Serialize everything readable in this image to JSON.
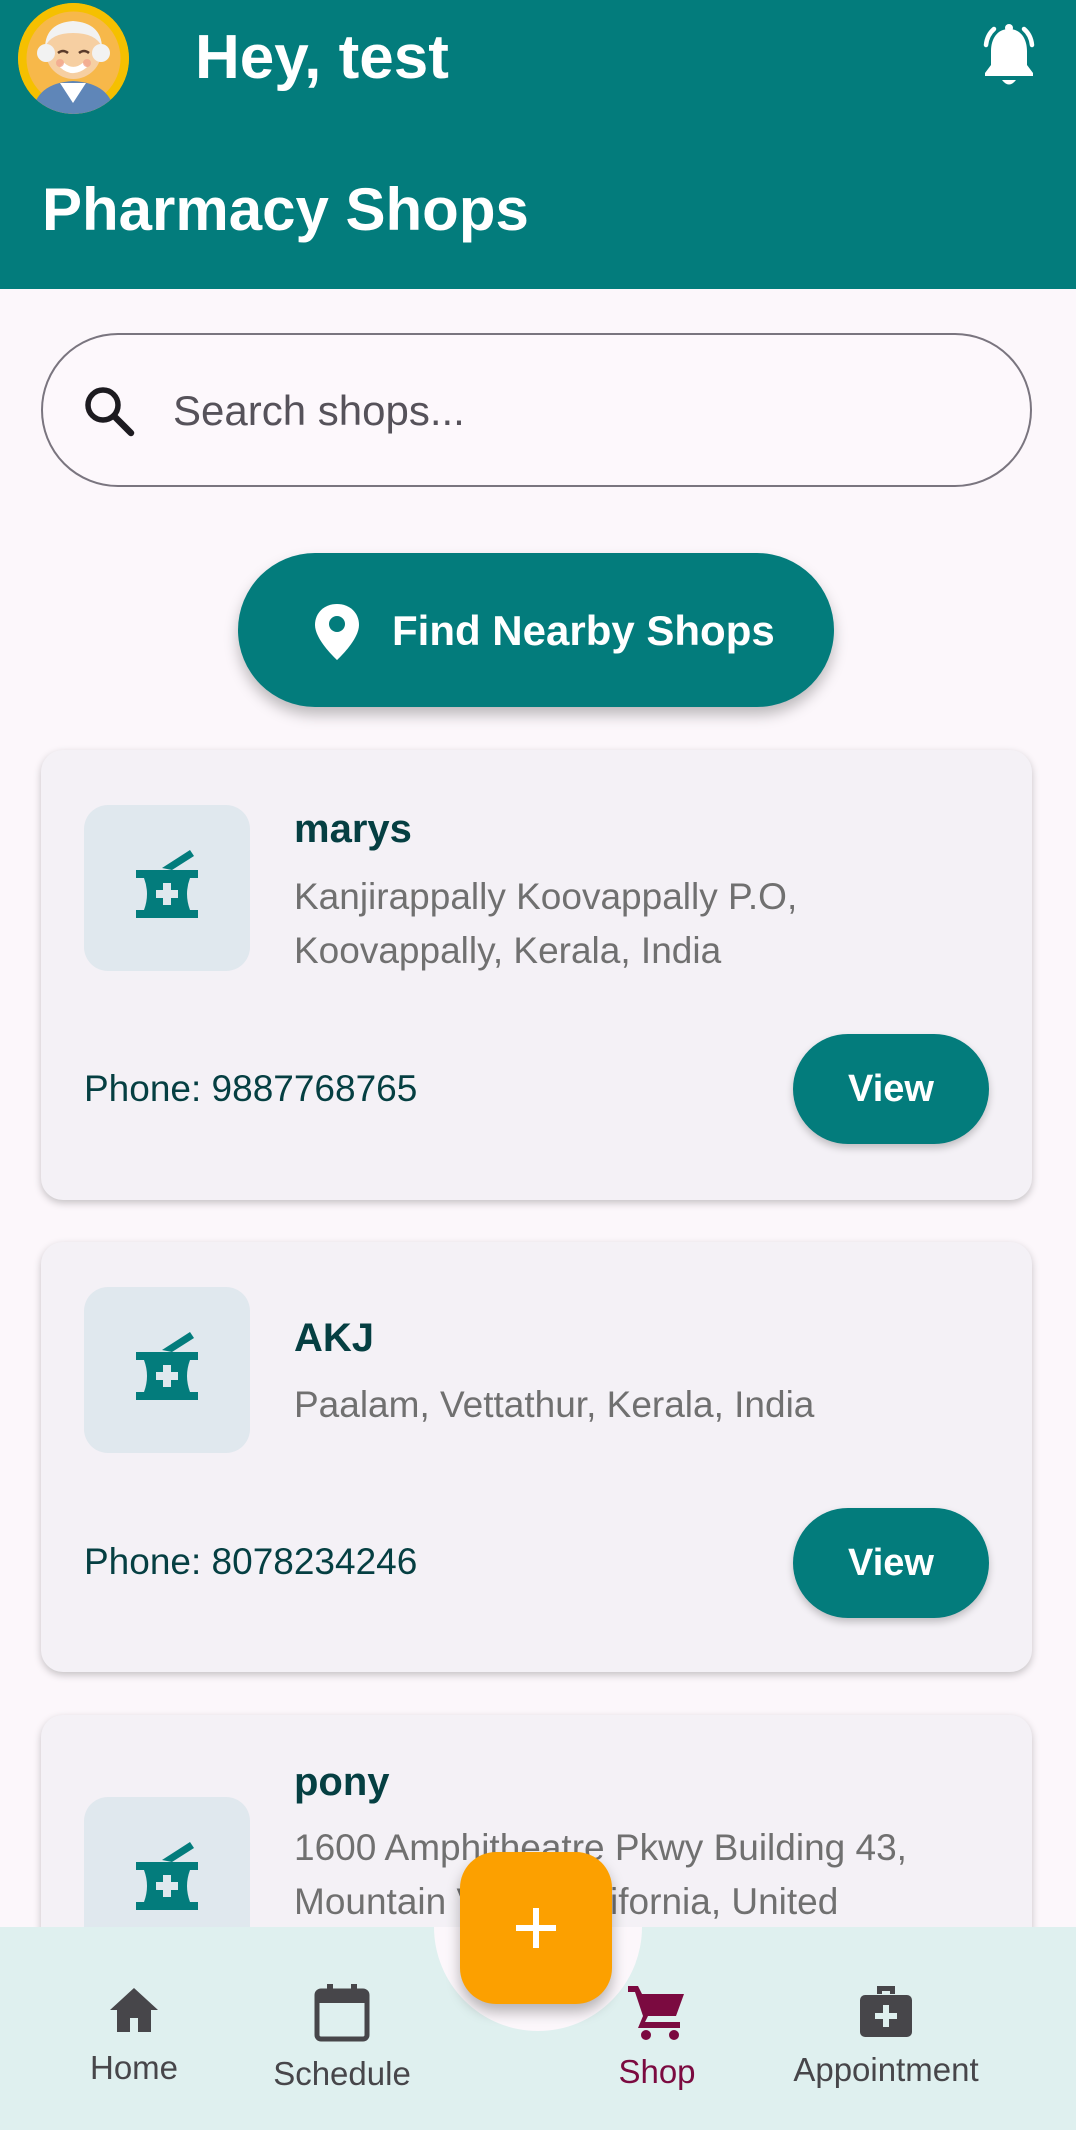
{
  "header": {
    "greeting": "Hey, test",
    "page_title": "Pharmacy Shops",
    "avatar_icon": "elderly-man-avatar",
    "bell_icon": "notification-bell-icon"
  },
  "search": {
    "placeholder": "Search shops..."
  },
  "nearby_button": {
    "label": "Find Nearby Shops",
    "icon": "location-pin-icon"
  },
  "shops": [
    {
      "name": "marys",
      "address_line1": "Kanjirappally Koovappally P.O,",
      "address_line2": "Koovappally, Kerala, India",
      "phone": "Phone: 9887768765",
      "view_label": "View"
    },
    {
      "name": "AKJ",
      "address_line1": "Paalam, Vettathur, Kerala, India",
      "phone": "Phone: 8078234246",
      "view_label": "View"
    },
    {
      "name": "pony",
      "address_line1": "1600 Amphitheatre Pkwy Building 43,",
      "address_line2": "Mountain View, California, United"
    }
  ],
  "bottom_nav": {
    "items": [
      {
        "label": "Home",
        "icon": "home-icon"
      },
      {
        "label": "Schedule",
        "icon": "calendar-icon"
      },
      {
        "label": "Shop",
        "icon": "shopping-cart-icon",
        "active": true
      },
      {
        "label": "Appointment",
        "icon": "medical-bag-icon"
      }
    ]
  },
  "fab": {
    "icon": "plus-icon"
  },
  "colors": {
    "primary": "#037c7c",
    "background": "#fcf7fb",
    "card": "#f4f1f6",
    "fab": "#fca000",
    "nav_active": "#7b0a40",
    "shop_name": "#053f42"
  }
}
